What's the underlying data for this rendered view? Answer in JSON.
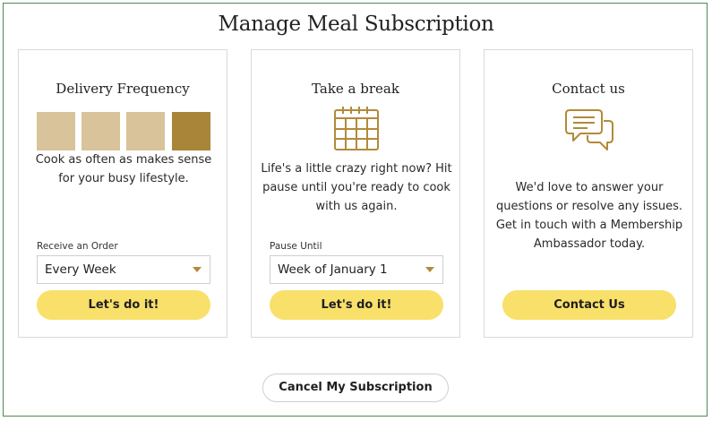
{
  "page": {
    "title": "Manage Meal Subscription"
  },
  "colors": {
    "accent_yellow": "#f8e06a",
    "gold": "#b28a3a",
    "swatch_light": "#d8c39a",
    "swatch_selected": "#a88538"
  },
  "cards": {
    "frequency": {
      "title": "Delivery Frequency",
      "swatches": [
        "light",
        "light",
        "light",
        "selected"
      ],
      "description": "Cook as often as makes sense for your busy lifestyle.",
      "field_label": "Receive an Order",
      "select_value": "Every Week",
      "button": "Let's do it!"
    },
    "pause": {
      "title": "Take a break",
      "icon": "calendar-icon",
      "description": "Life's a little crazy right now? Hit pause until you're ready to cook with us again.",
      "field_label": "Pause Until",
      "select_value": "Week of January 1",
      "button": "Let's do it!"
    },
    "contact": {
      "title": "Contact us",
      "icon": "chat-bubbles-icon",
      "description": "We'd love to answer your questions or resolve any issues. Get in touch with a Membership Ambassador today.",
      "button": "Contact Us"
    }
  },
  "footer": {
    "cancel_button": "Cancel My Subscription"
  }
}
